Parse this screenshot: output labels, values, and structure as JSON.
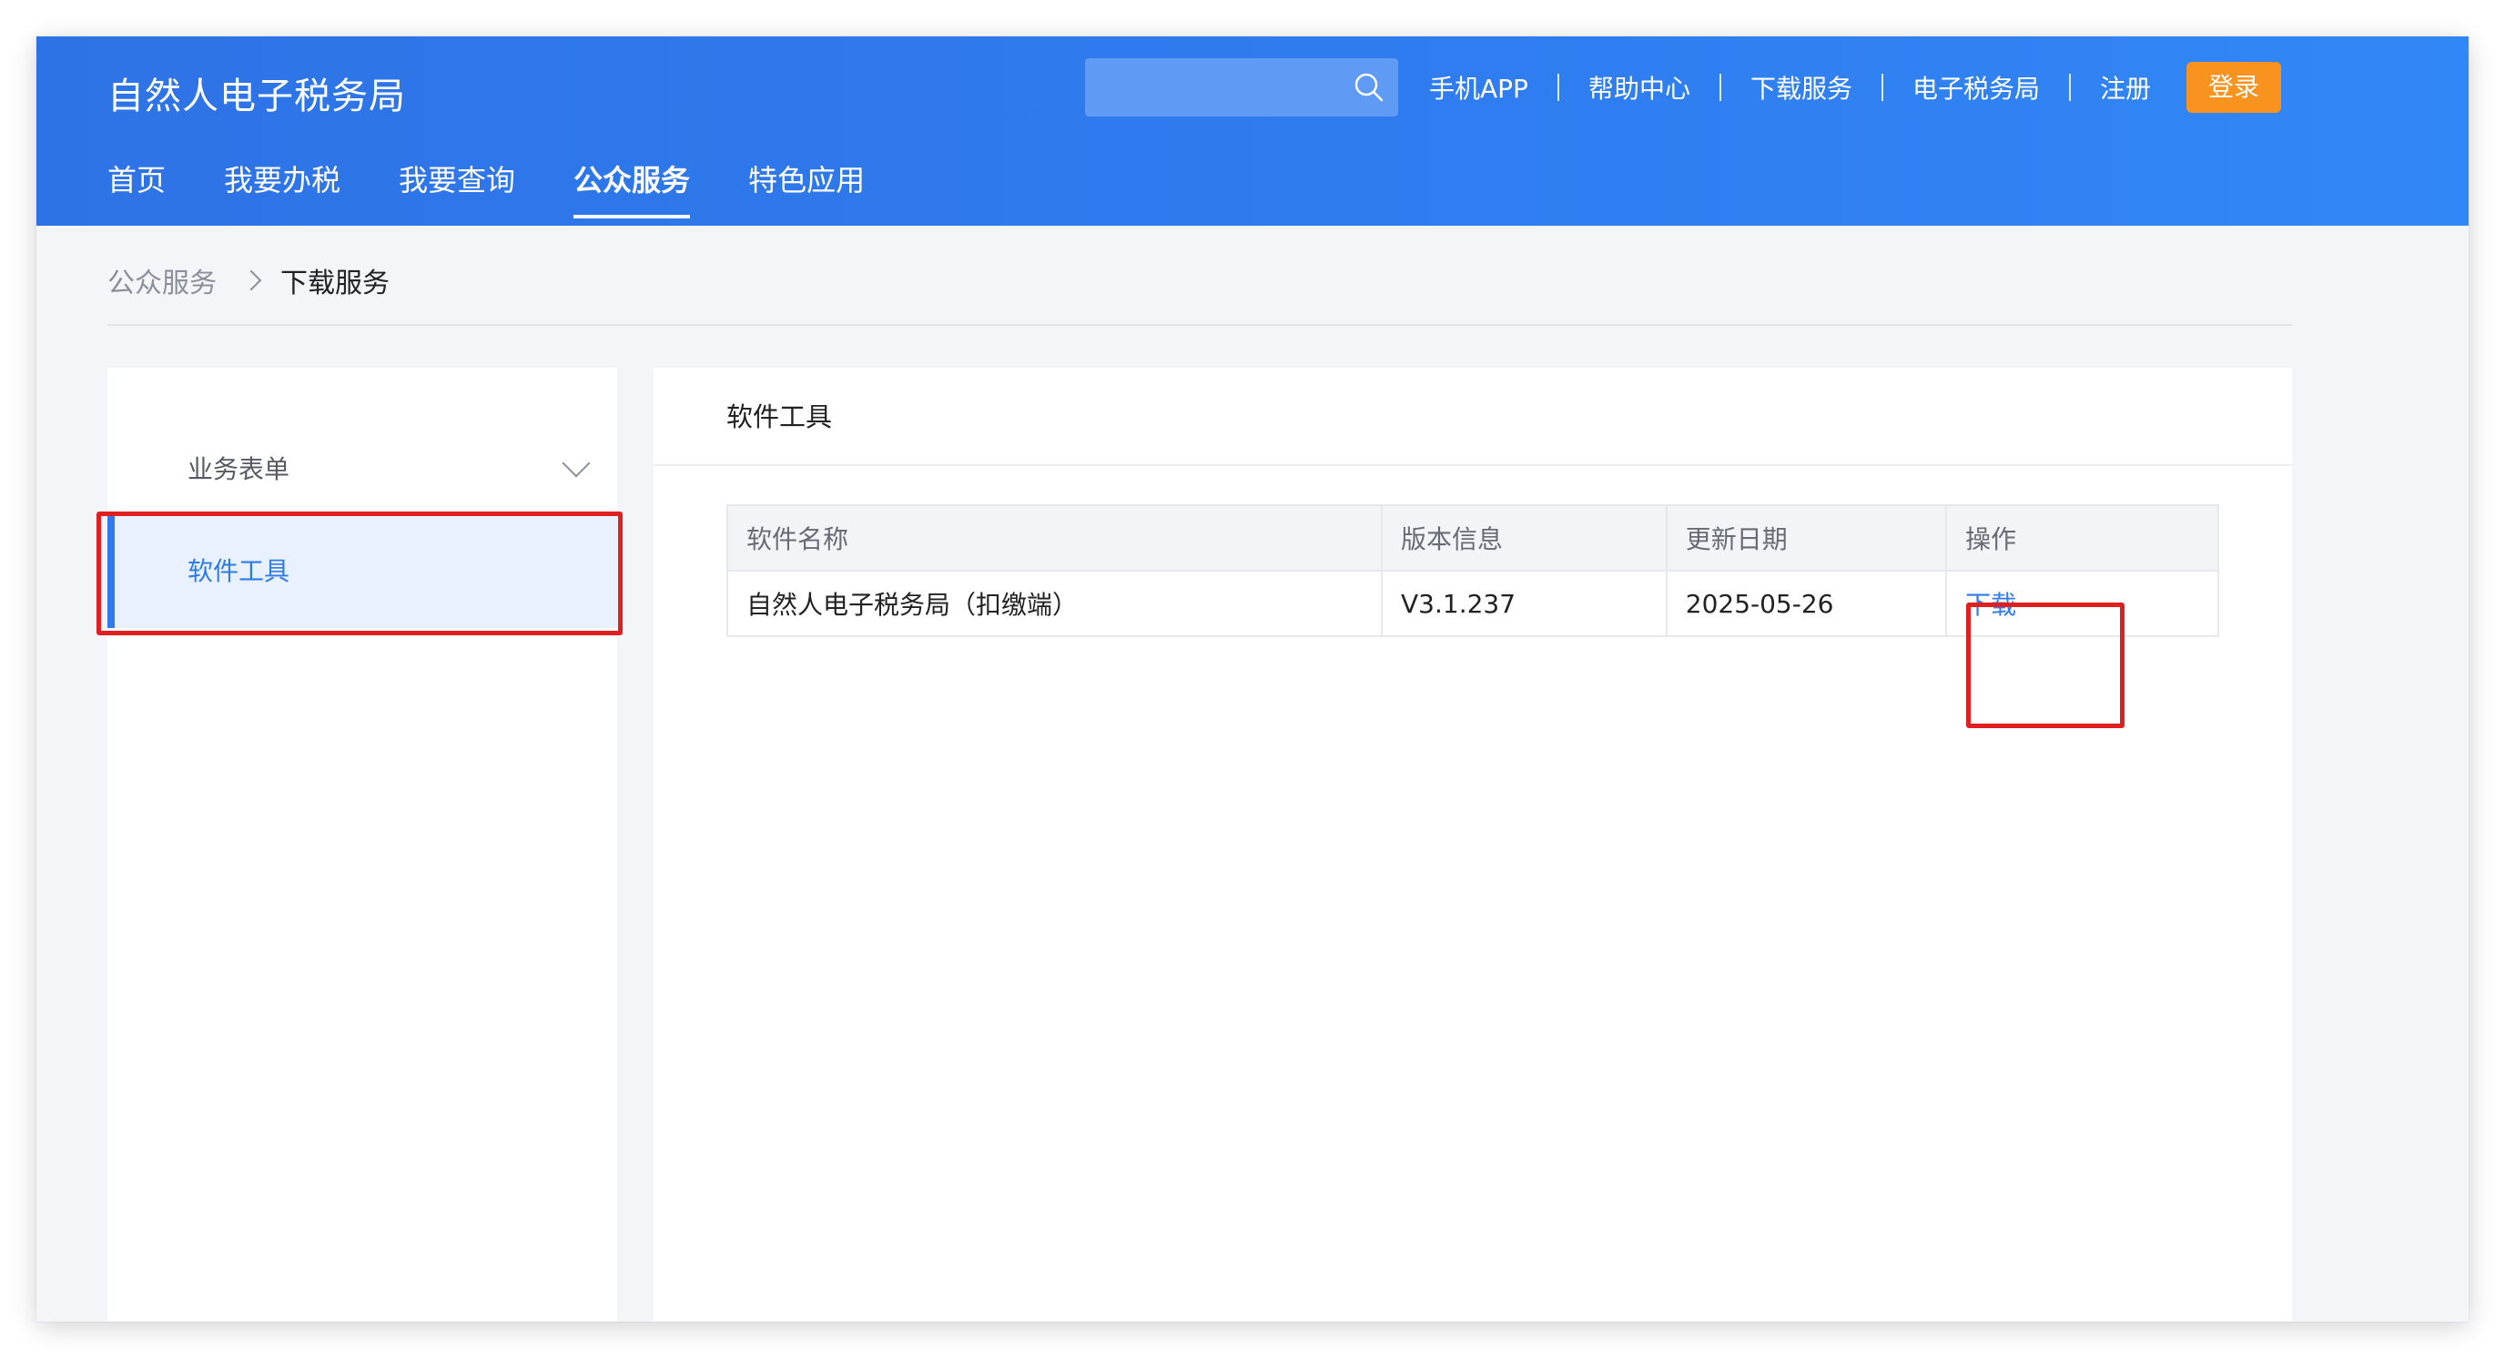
{
  "header": {
    "site_title": "自然人电子税务局",
    "search": {
      "placeholder": ""
    },
    "top_links": [
      "手机APP",
      "帮助中心",
      "下载服务",
      "电子税务局",
      "注册"
    ],
    "login_label": "登录"
  },
  "nav": {
    "items": [
      "首页",
      "我要办税",
      "我要查询",
      "公众服务",
      "特色应用"
    ],
    "active": "公众服务"
  },
  "breadcrumb": {
    "parent": "公众服务",
    "current": "下载服务"
  },
  "sidebar": {
    "group_label": "业务表单",
    "active_item": "软件工具"
  },
  "panel": {
    "title": "软件工具",
    "table": {
      "headers": [
        "软件名称",
        "版本信息",
        "更新日期",
        "操作"
      ],
      "rows": [
        {
          "name": "自然人电子税务局（扣缴端）",
          "version": "V3.1.237",
          "date": "2025-05-26",
          "action": "下载"
        }
      ]
    }
  },
  "colors": {
    "header_blue": "#2f7df0",
    "login_orange": "#f7931e",
    "link_blue": "#2f7be8",
    "highlight_red": "#e02020"
  },
  "icons": [
    "search-icon",
    "chevron-down-icon",
    "chevron-right-icon"
  ]
}
